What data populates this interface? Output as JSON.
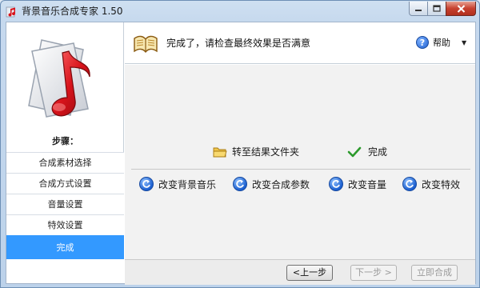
{
  "window": {
    "title": "背景音乐合成专家 1.50"
  },
  "sidebar": {
    "steps_title": "步骤：",
    "steps": [
      {
        "label": "合成素材选择",
        "active": false
      },
      {
        "label": "合成方式设置",
        "active": false
      },
      {
        "label": "音量设置",
        "active": false
      },
      {
        "label": "特效设置",
        "active": false
      },
      {
        "label": "完成",
        "active": true
      }
    ]
  },
  "header": {
    "title": "完成了，请检查最终效果是否满意",
    "help_label": "帮助"
  },
  "content": {
    "goto_folder": "转至结果文件夹",
    "finish": "完成",
    "actions": [
      {
        "label": "改变背景音乐"
      },
      {
        "label": "改变合成参数"
      },
      {
        "label": "改变音量"
      },
      {
        "label": "改变特效"
      }
    ]
  },
  "buttons": {
    "prev": "<上一步",
    "next": "下一步 >",
    "merge_now": "立即合成"
  },
  "colors": {
    "active_step": "#3399ff",
    "accent_blue": "#1e5fcf",
    "logo_red": "#d8131b"
  }
}
